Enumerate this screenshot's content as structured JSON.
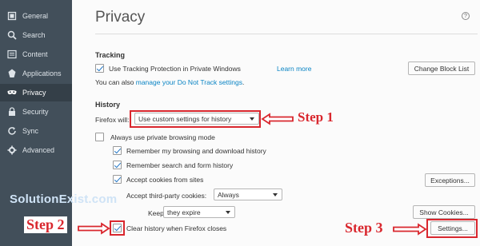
{
  "sidebar": {
    "items": [
      {
        "label": "General",
        "icon": "general-icon"
      },
      {
        "label": "Search",
        "icon": "search-icon"
      },
      {
        "label": "Content",
        "icon": "content-icon"
      },
      {
        "label": "Applications",
        "icon": "applications-icon"
      },
      {
        "label": "Privacy",
        "icon": "privacy-mask-icon",
        "selected": true
      },
      {
        "label": "Security",
        "icon": "security-icon"
      },
      {
        "label": "Sync",
        "icon": "sync-icon"
      },
      {
        "label": "Advanced",
        "icon": "advanced-icon"
      }
    ]
  },
  "header": {
    "title": "Privacy",
    "help": "?"
  },
  "tracking": {
    "heading": "Tracking",
    "protection_label": "Use Tracking Protection in Private Windows",
    "protection_checked": true,
    "learn_more": "Learn more",
    "change_block_list": "Change Block List",
    "dnt_prefix": "You can also ",
    "dnt_link": "manage your Do Not Track settings",
    "dnt_suffix": "."
  },
  "history": {
    "heading": "History",
    "firefox_will_label": "Firefox will:",
    "firefox_will_value": "Use custom settings for history",
    "private_mode_label": "Always use private browsing mode",
    "private_mode_checked": false,
    "remember_browsing_label": "Remember my browsing and download history",
    "remember_browsing_checked": true,
    "remember_search_label": "Remember search and form history",
    "remember_search_checked": true,
    "accept_cookies_label": "Accept cookies from sites",
    "accept_cookies_checked": true,
    "exceptions_button": "Exceptions...",
    "third_party_label": "Accept third-party cookies:",
    "third_party_value": "Always",
    "keep_until_label": "Keep until:",
    "keep_until_value": "they expire",
    "show_cookies_button": "Show Cookies...",
    "clear_on_close_label": "Clear history when Firefox closes",
    "clear_on_close_checked": true,
    "settings_button": "Settings..."
  },
  "annotations": {
    "step1": "Step 1",
    "step2": "Step 2",
    "step3": "Step 3",
    "watermark": "SolutionExist.com",
    "color": "#d9272e"
  }
}
